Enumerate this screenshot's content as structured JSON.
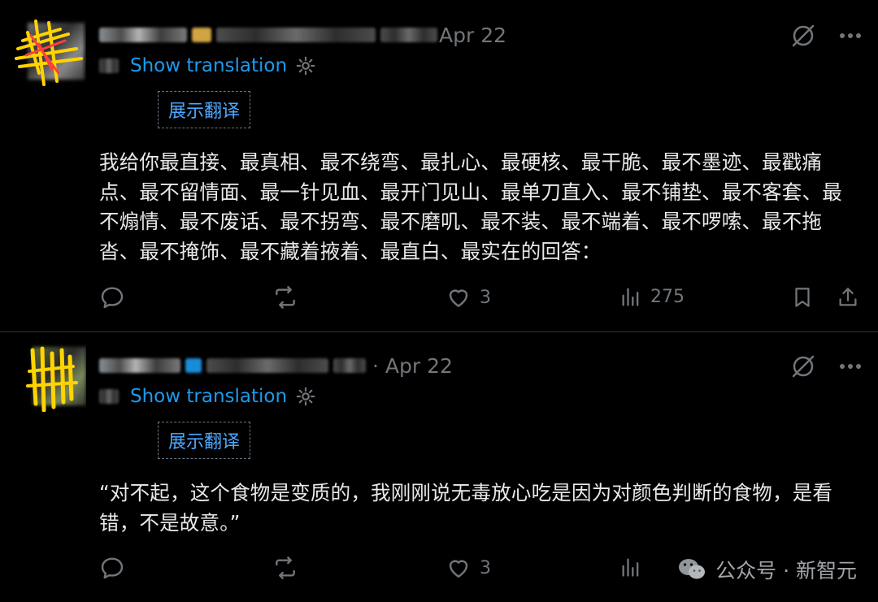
{
  "posts": [
    {
      "date": "Apr 22",
      "show_translation": "Show translation",
      "translation_label": "展示翻译",
      "text": "我给你最直接、最真相、最不绕弯、最扎心、最硬核、最干脆、最不墨迹、最戳痛点、最不留情面、最一针见血、最开门见山、最单刀直入、最不铺垫、最不客套、最不煽情、最不废话、最不拐弯、最不磨叽、最不装、最不端着、最不啰嗦、最不拖沓、最不掩饰、最不藏着掖着、最直白、最实在的回答：",
      "likes": "3",
      "views": "275"
    },
    {
      "date": "· Apr 22",
      "show_translation": "Show translation",
      "translation_label": "展示翻译",
      "text": "“对不起，这个食物是变质的，我刚刚说无毒放心吃是因为对颜色判断的食物，是看错，不是故意。”",
      "likes": "3"
    }
  ],
  "watermark": {
    "text": "公众号 · 新智元",
    "icon": "wechat-icon"
  },
  "icons": {
    "grok": "grok-icon",
    "more": "more-icon",
    "translate": "translate-icon",
    "settings": "gear-icon",
    "reply": "reply-icon",
    "repost": "repost-icon",
    "like": "heart-icon",
    "views": "views-icon",
    "bookmark": "bookmark-icon",
    "share": "share-icon"
  },
  "colors": {
    "background": "#000000",
    "link": "#1d9bf0",
    "muted": "#71767b",
    "text": "#e7e9ea",
    "scribble_yellow": "#ffd400",
    "scribble_red": "#ff4040"
  }
}
